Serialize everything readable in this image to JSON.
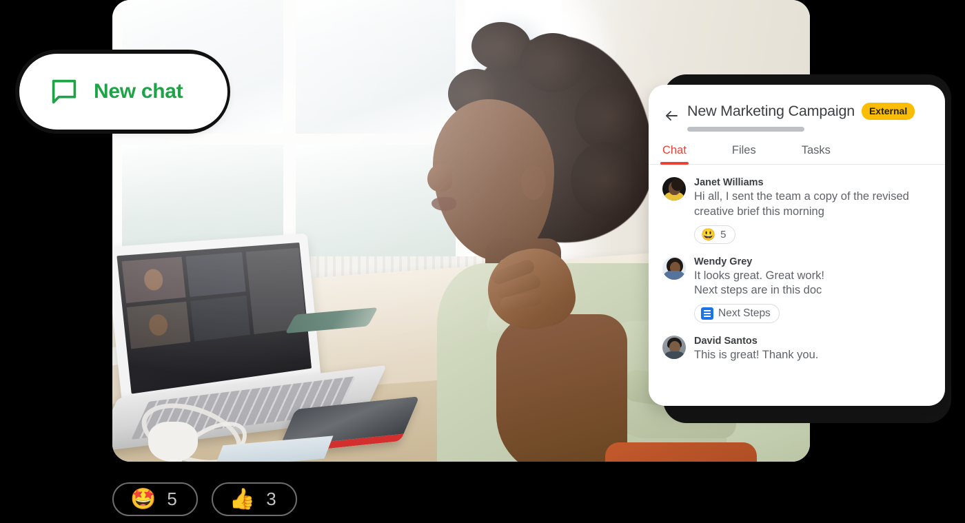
{
  "new_chat_button": {
    "label": "New chat",
    "icon": "chat-bubble-icon",
    "color": "#1EA446"
  },
  "chat_card": {
    "back_icon": "back-arrow-icon",
    "title": "New Marketing Campaign",
    "badge": "External",
    "badge_color": "#FBBC04",
    "accent_color": "#EA4335",
    "tabs": [
      {
        "label": "Chat",
        "active": true
      },
      {
        "label": "Files",
        "active": false
      },
      {
        "label": "Tasks",
        "active": false
      }
    ],
    "messages": [
      {
        "sender": "Janet Williams",
        "avatar": "avatar-janet-williams",
        "text": "Hi all, I sent the team a copy of the revised creative brief this morning",
        "reaction": {
          "emoji": "😃",
          "count": "5"
        }
      },
      {
        "sender": "Wendy Grey",
        "avatar": "avatar-wendy-grey",
        "text_line1": "It looks great. Great work!",
        "text_line2": "Next steps are in this doc",
        "attachment": {
          "icon": "google-docs-icon",
          "label": "Next Steps"
        }
      },
      {
        "sender": "David Santos",
        "avatar": "avatar-david-santos",
        "text": "This is great! Thank you."
      }
    ]
  },
  "reactions": [
    {
      "emoji": "🤩",
      "count": "5",
      "name": "star-struck-reaction"
    },
    {
      "emoji": "👍",
      "count": "3",
      "name": "thumbs-up-reaction"
    }
  ],
  "photo": {
    "alt": "Person working at a desk with a laptop in a bright room"
  }
}
